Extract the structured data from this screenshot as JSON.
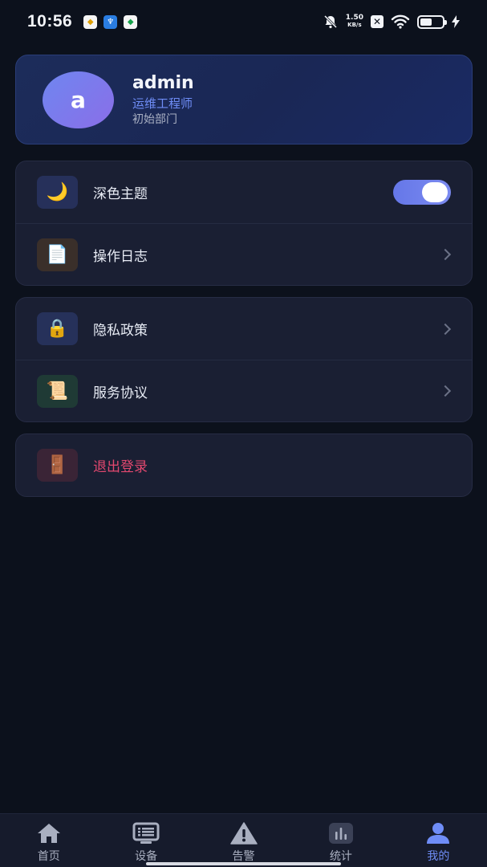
{
  "status_bar": {
    "time": "10:56",
    "net_speed_value": "1.50",
    "net_speed_unit": "KB/s"
  },
  "profile": {
    "avatar_letter": "a",
    "username": "admin",
    "role": "运维工程师",
    "department": "初始部门"
  },
  "group_preferences": {
    "items": [
      {
        "label": "深色主题",
        "icon": "moon-icon",
        "icon_glyph": "🌙",
        "toggle_on": true
      },
      {
        "label": "操作日志",
        "icon": "document-icon",
        "icon_glyph": "📄"
      }
    ]
  },
  "group_legal": {
    "items": [
      {
        "label": "隐私政策",
        "icon": "lock-icon",
        "icon_glyph": "🔒"
      },
      {
        "label": "服务协议",
        "icon": "scroll-icon",
        "icon_glyph": "📜"
      }
    ]
  },
  "logout": {
    "label": "退出登录",
    "icon": "door-icon",
    "icon_glyph": "🚪",
    "color": "#e2486f"
  },
  "bottom_nav": {
    "items": [
      {
        "label": "首页",
        "icon": "home-icon",
        "active": false
      },
      {
        "label": "设备",
        "icon": "device-list-icon",
        "active": false
      },
      {
        "label": "告警",
        "icon": "warning-icon",
        "active": false
      },
      {
        "label": "统计",
        "icon": "stats-icon",
        "active": false
      },
      {
        "label": "我的",
        "icon": "user-icon",
        "active": true
      }
    ],
    "active_color": "#6f8df7",
    "inactive_color": "#a9afc0"
  }
}
